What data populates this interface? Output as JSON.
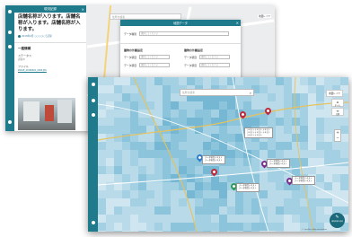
{
  "back_window": {
    "panel": {
      "header_title": "現況記録",
      "close_icon": "×",
      "title": "店舗名称が入ります。店舗名称が入ります。店舗名称が入ります。",
      "subtitle": "2018年4月 ○○○○にて記録",
      "section": "一般情報",
      "fields": [
        {
          "label": "ステータス",
          "value": "調査中"
        }
      ],
      "file_label": "ファイル",
      "file_name": "IMAGE_20180601_0000.JPG"
    },
    "map": {
      "search_placeholder": "住所を検索",
      "layer_button": "地図レイヤ"
    },
    "dialog": {
      "title": "地図データ",
      "close_icon": "×",
      "data_type_label": "データ種別",
      "data_type_value": "選択してください",
      "left_column_title": "建物の外観設定",
      "right_column_title": "建物の外観設定",
      "rows": [
        {
          "label": "データ項目",
          "value": "選択してください"
        },
        {
          "label": "データ項目",
          "value": "選択してください"
        }
      ],
      "right_rows": [
        {
          "label": "データ項目",
          "value": "選択してください"
        },
        {
          "label": "データ項目",
          "value": "選択してください"
        }
      ]
    }
  },
  "front_window": {
    "search_placeholder": "住所を検索",
    "layer_button": "地図レイヤ",
    "tools": [
      {
        "icon": "home-icon",
        "glyph": "⌂",
        "label": "ホーム"
      },
      {
        "icon": "layers-icon",
        "glyph": "≡",
        "label": "凡例"
      }
    ],
    "zoom": {
      "in": "+",
      "out": "−"
    },
    "fab_label": "現況記録を追加",
    "fab_glyph": "✎",
    "popups": [
      {
        "lines": [
          "テキストテキストテキスト",
          "テキストテキストテキスト",
          "テキストテキスト"
        ]
      },
      {
        "lines": [
          "データ項目テキスト",
          "データ項目テキスト"
        ]
      },
      {
        "lines": [
          "データ項目テキスト",
          "データ項目テキスト"
        ]
      },
      {
        "lines": [
          "データ項目テキスト",
          "データ項目テキスト"
        ]
      },
      {
        "lines": [
          "データ項目テキスト",
          "データ項目テキスト"
        ]
      }
    ],
    "footer": "© OpenStreetMap contributors",
    "colors": {
      "rail": "#1f7a8c",
      "map_base": "#cfe5ef",
      "pin_red": "#c0283c",
      "pin_purple": "#7a2f8f",
      "pin_green": "#2e9a5a",
      "pin_blue": "#2f7fd0"
    }
  }
}
